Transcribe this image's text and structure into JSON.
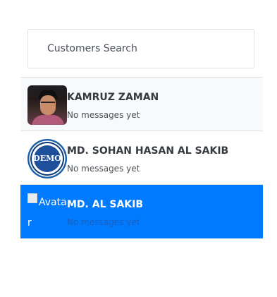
{
  "search": {
    "placeholder": "Customers Search"
  },
  "customers": [
    {
      "name": "KAMRUZ ZAMAN",
      "preview": "No messages yet",
      "avatar": "photo-avatar"
    },
    {
      "name": "MD. SOHAN HASAN AL SAKIB",
      "preview": "No messages yet",
      "avatar": "demo-avatar",
      "avatar_text": "DEMO"
    },
    {
      "name": "MD. AL SAKIB",
      "preview": "No messages yet",
      "avatar": "broken-avatar",
      "avatar_alt": "Avatar",
      "active": true
    }
  ],
  "colors": {
    "active_bg": "#007bff",
    "hover_bg": "#f8f9fa",
    "border": "#dee2e6"
  }
}
